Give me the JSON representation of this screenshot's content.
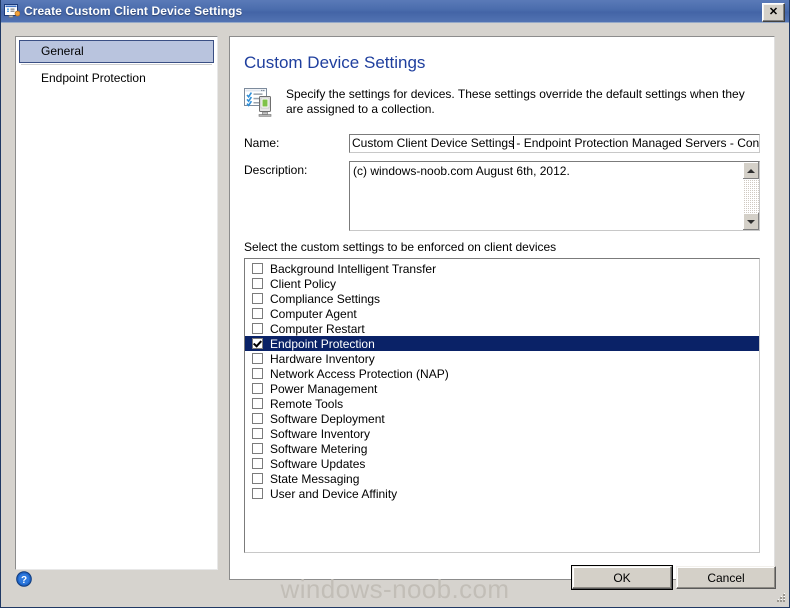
{
  "window": {
    "title": "Create Custom Client Device Settings",
    "icon": "settings-window-icon",
    "close_label": "✕",
    "accent_titlebar": "#4a6cac",
    "surface": "#d6d3ce"
  },
  "sidebar": {
    "items": [
      {
        "label": "General",
        "selected": true
      },
      {
        "label": "Endpoint Protection",
        "selected": false
      }
    ]
  },
  "content": {
    "title": "Custom Device Settings",
    "title_color": "#1f3f9e",
    "icon": "device-settings-icon",
    "description": "Specify the settings for devices. These settings override the default settings when they are assigned to a collection.",
    "name_label": "Name:",
    "name_value_before_caret": "Custom Client Device Settings",
    "name_value_after_caret": " - Endpoint Protection Managed Servers - Configuration",
    "description_label": "Description:",
    "description_value": "(c) windows-noob.com August 6th, 2012.",
    "list_caption": "Select the custom settings to be enforced on client devices",
    "selection_highlight": "#0a2267"
  },
  "settings_list": [
    {
      "label": "Background Intelligent Transfer",
      "checked": false,
      "selected": false
    },
    {
      "label": "Client Policy",
      "checked": false,
      "selected": false
    },
    {
      "label": "Compliance Settings",
      "checked": false,
      "selected": false
    },
    {
      "label": "Computer Agent",
      "checked": false,
      "selected": false
    },
    {
      "label": "Computer Restart",
      "checked": false,
      "selected": false
    },
    {
      "label": "Endpoint Protection",
      "checked": true,
      "selected": true
    },
    {
      "label": "Hardware Inventory",
      "checked": false,
      "selected": false
    },
    {
      "label": "Network Access Protection (NAP)",
      "checked": false,
      "selected": false
    },
    {
      "label": "Power Management",
      "checked": false,
      "selected": false
    },
    {
      "label": "Remote Tools",
      "checked": false,
      "selected": false
    },
    {
      "label": "Software Deployment",
      "checked": false,
      "selected": false
    },
    {
      "label": "Software Inventory",
      "checked": false,
      "selected": false
    },
    {
      "label": "Software Metering",
      "checked": false,
      "selected": false
    },
    {
      "label": "Software Updates",
      "checked": false,
      "selected": false
    },
    {
      "label": "State Messaging",
      "checked": false,
      "selected": false
    },
    {
      "label": "User and Device Affinity",
      "checked": false,
      "selected": false
    }
  ],
  "footer": {
    "help_icon": "help-circle-icon",
    "watermark": "windows-noob.com",
    "ok_label": "OK",
    "cancel_label": "Cancel"
  }
}
